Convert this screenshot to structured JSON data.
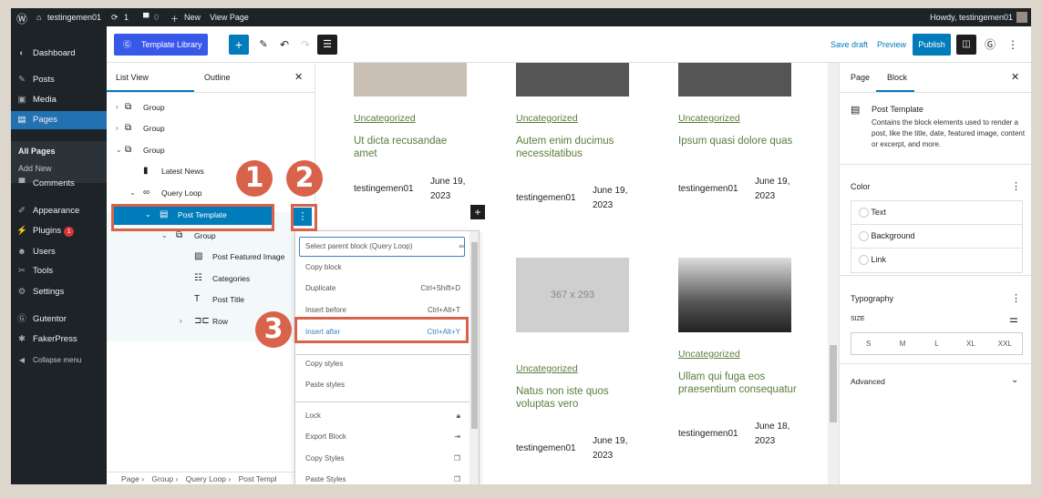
{
  "adminbar": {
    "site": "testingemen01",
    "updates": "1",
    "comments": "0",
    "new": "New",
    "view": "View Page",
    "howdy": "Howdy, testingemen01"
  },
  "sidebar": {
    "items": [
      {
        "label": "Dashboard",
        "icon": "dashboard-icon"
      },
      {
        "label": "Posts",
        "icon": "pin-icon"
      },
      {
        "label": "Media",
        "icon": "media-icon"
      },
      {
        "label": "Pages",
        "icon": "pages-icon"
      },
      {
        "label": "Comments",
        "icon": "comment-icon"
      },
      {
        "label": "Appearance",
        "icon": "brush-icon"
      },
      {
        "label": "Plugins",
        "icon": "plugin-icon"
      },
      {
        "label": "Users",
        "icon": "users-icon"
      },
      {
        "label": "Tools",
        "icon": "tools-icon"
      },
      {
        "label": "Settings",
        "icon": "settings-icon"
      },
      {
        "label": "Gutentor",
        "icon": "gutentor-icon"
      },
      {
        "label": "FakerPress",
        "icon": "fakerpress-icon"
      },
      {
        "label": "Collapse menu",
        "icon": "collapse-icon"
      }
    ],
    "sub": [
      "All Pages",
      "Add New"
    ],
    "plugins_badge": "1"
  },
  "toolbar": {
    "template_library": "Template Library",
    "save_draft": "Save draft",
    "preview": "Preview",
    "publish": "Publish"
  },
  "listview": {
    "tabs": [
      "List View",
      "Outline"
    ],
    "rows": [
      "Group",
      "Group",
      "Group",
      "Latest News",
      "Query Loop",
      "Post Template",
      "Group",
      "Post Featured Image",
      "Categories",
      "Post Title",
      "Row"
    ]
  },
  "breadcrumb": [
    "Page",
    "Group",
    "Query Loop",
    "Post Templ"
  ],
  "posts": [
    {
      "cat": "Uncategorized",
      "title": "Ut dicta recusandae amet",
      "author": "testingemen01",
      "date1": "June 19,",
      "date2": "2023"
    },
    {
      "cat": "Uncategorized",
      "title": "Autem enim ducimus necessitatibus",
      "author": "testingemen01",
      "date1": "June 19,",
      "date2": "2023"
    },
    {
      "cat": "Uncategorized",
      "title": "Ipsum quasi dolore quas",
      "author": "testingemen01",
      "date1": "June 19,",
      "date2": "2023"
    },
    {
      "cat": "Uncategorized",
      "title": "Natus non iste quos voluptas vero",
      "author": "testingemen01",
      "date1": "June 19,",
      "date2": "2023",
      "placeholder": "367 x 293"
    },
    {
      "cat": "Uncategorized",
      "title": "Ullam qui fuga eos praesentium consequatur",
      "author": "testingemen01",
      "date1": "June 18,",
      "date2": "2023"
    }
  ],
  "menu": {
    "items": [
      {
        "label": "Select parent block (Query Loop)",
        "shortcut": ""
      },
      {
        "label": "Copy block",
        "shortcut": ""
      },
      {
        "label": "Duplicate",
        "shortcut": "Ctrl+Shift+D"
      },
      {
        "label": "Insert before",
        "shortcut": "Ctrl+Alt+T"
      },
      {
        "label": "Insert after",
        "shortcut": "Ctrl+Alt+Y"
      },
      {
        "label": "Copy styles",
        "shortcut": ""
      },
      {
        "label": "Paste styles",
        "shortcut": ""
      },
      {
        "label": "Lock",
        "shortcut": ""
      },
      {
        "label": "Export Block",
        "shortcut": ""
      },
      {
        "label": "Copy Styles",
        "shortcut": ""
      },
      {
        "label": "Paste Styles",
        "shortcut": ""
      }
    ]
  },
  "panel": {
    "tabs": [
      "Page",
      "Block"
    ],
    "block_title": "Post Template",
    "block_desc": "Contains the block elements used to render a post, like the title, date, featured image, content or excerpt, and more.",
    "color": "Color",
    "colors": [
      "Text",
      "Background",
      "Link"
    ],
    "typography": "Typography",
    "size": "SIZE",
    "sizes": [
      "S",
      "M",
      "L",
      "XL",
      "XXL"
    ],
    "advanced": "Advanced"
  },
  "annotations": [
    "1",
    "2",
    "3"
  ],
  "colors": {
    "accent": "#007cba",
    "annotation": "#d9634a",
    "link": "#5b7c3a"
  }
}
